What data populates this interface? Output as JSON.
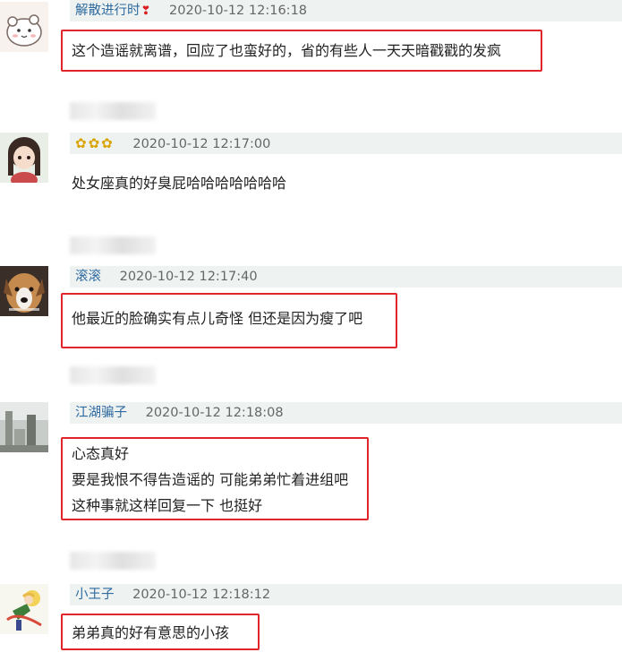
{
  "comments": [
    {
      "username": "解散进行时",
      "time": "2020-10-12 12:16:18",
      "lines": [
        "这个造谣就离谱，回应了也蛮好的，省的有些人一天天暗戳戳的发疯"
      ],
      "highlighted": true,
      "avatar": "cartoon-bear"
    },
    {
      "username": "",
      "time": "2020-10-12 12:17:00",
      "lines": [
        "处女座真的好臭屁哈哈哈哈哈哈哈"
      ],
      "highlighted": false,
      "avatar": "anime-girl"
    },
    {
      "username": "滚滚",
      "time": "2020-10-12 12:17:40",
      "lines": [
        "他最近的脸确实有点儿奇怪 但还是因为瘦了吧"
      ],
      "highlighted": true,
      "avatar": "dog"
    },
    {
      "username": "江湖骗子",
      "time": "2020-10-12 12:18:08",
      "lines": [
        "心态真好",
        "要是我恨不得告造谣的 可能弟弟忙着进组吧",
        "这种事就这样回复一下 也挺好"
      ],
      "highlighted": true,
      "avatar": "street-photo"
    },
    {
      "username": "小王子",
      "time": "2020-10-12 12:18:12",
      "lines": [
        "弟弟真的好有意思的小孩"
      ],
      "highlighted": true,
      "avatar": "little-prince"
    }
  ],
  "icons": {
    "heart": "heart-icon",
    "flower": "sunflower-icon"
  },
  "colors": {
    "highlight_border": "#e0262b",
    "username": "#2f6aa0",
    "meta_background": "#eef3f1"
  }
}
